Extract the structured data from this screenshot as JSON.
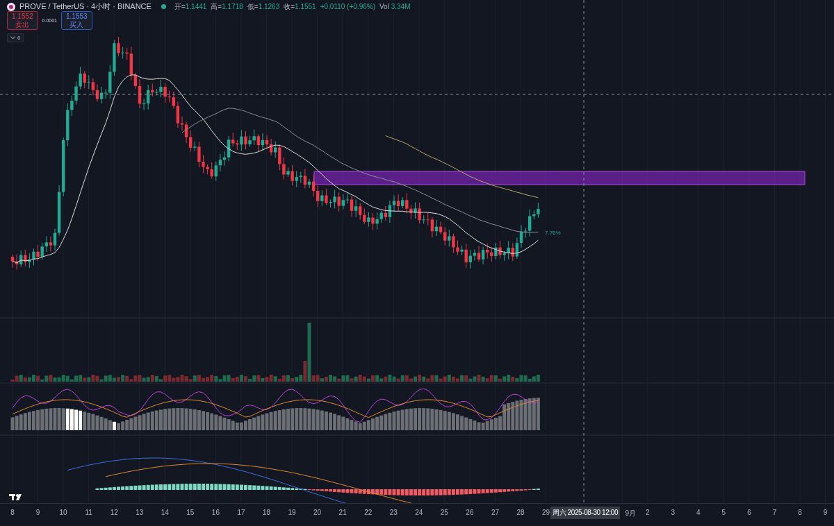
{
  "header": {
    "symbol": "PROVE / TetherUS · 4小时 · BINANCE",
    "ohlc": [
      {
        "label": "开=",
        "value": "1.1441"
      },
      {
        "label": "高=",
        "value": "1.1718"
      },
      {
        "label": "低=",
        "value": "1.1263"
      },
      {
        "label": "收=",
        "value": "1.1551"
      }
    ],
    "change": "+0.0110 (+0.96%)",
    "volume_label": "Vol",
    "volume_value": "3.34M"
  },
  "order": {
    "sell_price": "1.1552",
    "sell_label": "卖出",
    "spread": "0.0001",
    "buy_price": "1.1553",
    "buy_label": "买入"
  },
  "indicators": {
    "count": "6",
    "expanded": false
  },
  "price_label": "7.76%",
  "x_axis": {
    "ticks": [
      "8",
      "9",
      "10",
      "11",
      "12",
      "13",
      "14",
      "15",
      "16",
      "17",
      "18",
      "19",
      "20",
      "21",
      "22",
      "23",
      "24",
      "25",
      "26",
      "27",
      "28",
      "29",
      "9月",
      "2",
      "3",
      "4",
      "5",
      "6",
      "7",
      "8",
      "9"
    ],
    "crosshair_label": "周六 2025-08-30 12:00"
  }
}
